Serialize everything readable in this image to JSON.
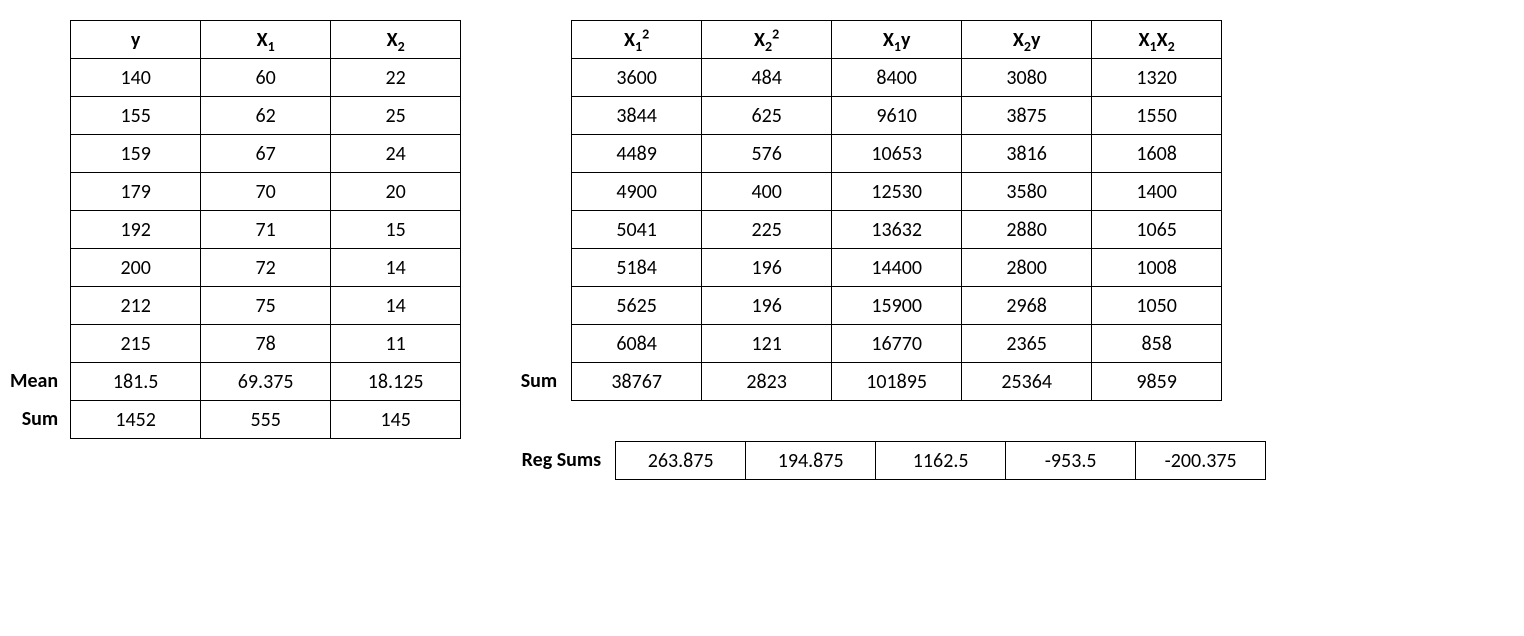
{
  "left": {
    "headers": {
      "y": "y",
      "x1": "X",
      "x1s": "1",
      "x2": "X",
      "x2s": "2"
    },
    "rowlabels": {
      "mean": "Mean",
      "sum": "Sum"
    },
    "rows": [
      {
        "y": "140",
        "x1": "60",
        "x2": "22"
      },
      {
        "y": "155",
        "x1": "62",
        "x2": "25"
      },
      {
        "y": "159",
        "x1": "67",
        "x2": "24"
      },
      {
        "y": "179",
        "x1": "70",
        "x2": "20"
      },
      {
        "y": "192",
        "x1": "71",
        "x2": "15"
      },
      {
        "y": "200",
        "x1": "72",
        "x2": "14"
      },
      {
        "y": "212",
        "x1": "75",
        "x2": "14"
      },
      {
        "y": "215",
        "x1": "78",
        "x2": "11"
      }
    ],
    "mean": {
      "y": "181.5",
      "x1": "69.375",
      "x2": "18.125"
    },
    "sum": {
      "y": "1452",
      "x1": "555",
      "x2": "145"
    }
  },
  "right": {
    "label_sum": "Sum",
    "headers": {
      "c1a": "X",
      "c1b": "1",
      "c1c": "2",
      "c2a": "X",
      "c2b": "2",
      "c2c": "2",
      "c3a": "X",
      "c3b": "1",
      "c3c": "y",
      "c4a": "X",
      "c4b": "2",
      "c4c": "y",
      "c5a": "X",
      "c5b": "1",
      "c5c": "X",
      "c5d": "2"
    },
    "rows": [
      {
        "c1": "3600",
        "c2": "484",
        "c3": "8400",
        "c4": "3080",
        "c5": "1320"
      },
      {
        "c1": "3844",
        "c2": "625",
        "c3": "9610",
        "c4": "3875",
        "c5": "1550"
      },
      {
        "c1": "4489",
        "c2": "576",
        "c3": "10653",
        "c4": "3816",
        "c5": "1608"
      },
      {
        "c1": "4900",
        "c2": "400",
        "c3": "12530",
        "c4": "3580",
        "c5": "1400"
      },
      {
        "c1": "5041",
        "c2": "225",
        "c3": "13632",
        "c4": "2880",
        "c5": "1065"
      },
      {
        "c1": "5184",
        "c2": "196",
        "c3": "14400",
        "c4": "2800",
        "c5": "1008"
      },
      {
        "c1": "5625",
        "c2": "196",
        "c3": "15900",
        "c4": "2968",
        "c5": "1050"
      },
      {
        "c1": "6084",
        "c2": "121",
        "c3": "16770",
        "c4": "2365",
        "c5": "858"
      }
    ],
    "sum": {
      "c1": "38767",
      "c2": "2823",
      "c3": "101895",
      "c4": "25364",
      "c5": "9859"
    }
  },
  "reg": {
    "label": "Reg Sums",
    "vals": {
      "c1": "263.875",
      "c2": "194.875",
      "c3": "1162.5",
      "c4": "-953.5",
      "c5": "-200.375"
    }
  }
}
